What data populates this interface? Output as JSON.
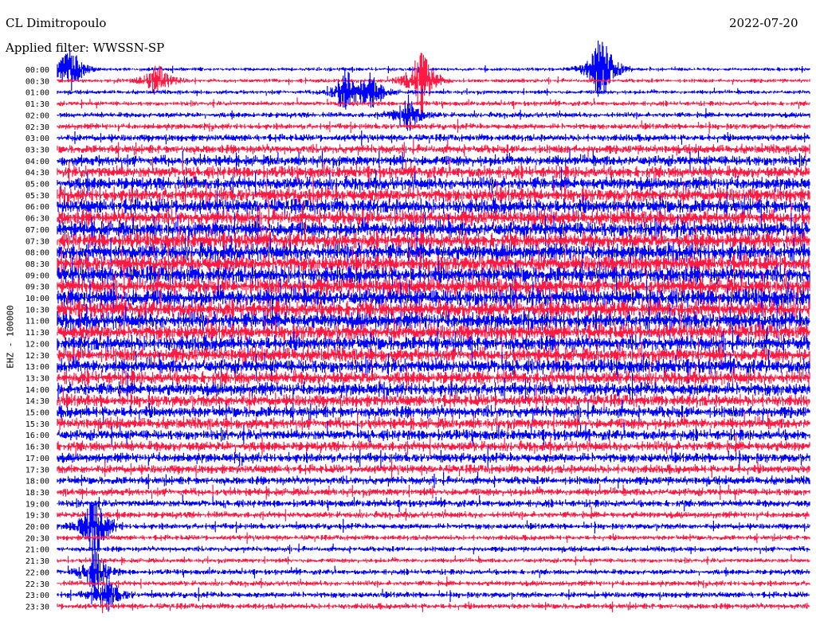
{
  "header": {
    "station": "CL Dimitropoulo",
    "date": "2022-07-20",
    "filter": "Applied filter: WWSSN-SP"
  },
  "side_label": "EHZ - 100000",
  "colors": {
    "trace_a": "#0000ff",
    "trace_b": "#ff1a44",
    "background": "#ffffff",
    "text": "#000000"
  },
  "chart_data": {
    "type": "line",
    "title": "CL Dimitropoulo",
    "subtitle": "Applied filter: WWSSN-SP",
    "ylabel": "EHZ - 100000",
    "xlabel": "",
    "date": "2022-07-20",
    "row_minutes": 30,
    "row_labels": [
      "00:00",
      "00:30",
      "01:00",
      "01:30",
      "02:00",
      "02:30",
      "03:00",
      "03:30",
      "04:00",
      "04:30",
      "05:00",
      "05:30",
      "06:00",
      "06:30",
      "07:00",
      "07:30",
      "08:00",
      "08:30",
      "09:00",
      "09:30",
      "10:00",
      "10:30",
      "11:00",
      "11:30",
      "12:00",
      "12:30",
      "13:00",
      "13:30",
      "14:00",
      "14:30",
      "15:00",
      "15:30",
      "16:00",
      "16:30",
      "17:00",
      "17:30",
      "18:00",
      "18:30",
      "19:00",
      "19:30",
      "20:00",
      "20:30",
      "21:00",
      "21:30",
      "22:00",
      "22:30",
      "23:00",
      "23:30"
    ],
    "series": [
      {
        "color": "#0000ff",
        "rows": "even"
      },
      {
        "color": "#ff1a44",
        "rows": "odd"
      }
    ],
    "relative_amplitude": [
      0.3,
      0.35,
      0.35,
      0.4,
      0.45,
      0.5,
      0.6,
      0.75,
      0.9,
      1.0,
      1.1,
      1.2,
      1.25,
      1.3,
      1.35,
      1.35,
      1.4,
      1.45,
      1.45,
      1.45,
      1.5,
      1.45,
      1.4,
      1.35,
      1.3,
      1.25,
      1.2,
      1.15,
      1.1,
      1.05,
      1.0,
      0.95,
      0.9,
      0.85,
      0.8,
      0.75,
      0.7,
      0.65,
      0.6,
      0.55,
      0.5,
      0.45,
      0.45,
      0.4,
      0.45,
      0.45,
      0.5,
      0.5
    ],
    "events": [
      {
        "row": 0,
        "minute": 0.5,
        "amp": 6
      },
      {
        "row": 0,
        "minute": 21.7,
        "amp": 9
      },
      {
        "row": 1,
        "minute": 4,
        "amp": 4
      },
      {
        "row": 1,
        "minute": 14.5,
        "amp": 8
      },
      {
        "row": 2,
        "minute": 12.5,
        "amp": 4
      },
      {
        "row": 2,
        "minute": 11.5,
        "amp": 5
      },
      {
        "row": 4,
        "minute": 14,
        "amp": 4
      },
      {
        "row": 46,
        "minute": 2,
        "amp": 4
      },
      {
        "row": 44,
        "minute": 1.5,
        "amp": 5
      },
      {
        "row": 40,
        "minute": 1.5,
        "amp": 8
      }
    ]
  }
}
